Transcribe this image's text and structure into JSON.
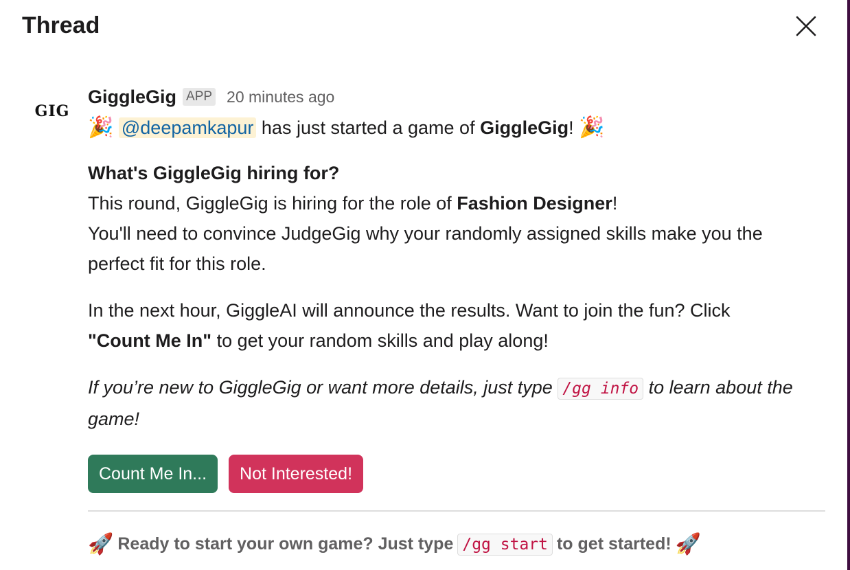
{
  "panel": {
    "title": "Thread"
  },
  "message": {
    "avatar_text": "GIG",
    "sender": "GiggleGig",
    "badge": "APP",
    "timestamp": "20 minutes ago",
    "intro": {
      "emoji": "🎉",
      "mention": "@deepamkapur",
      "text_before_bold": " has just started a game of ",
      "bold": "GiggleGig",
      "text_after_bold": "!"
    },
    "hiring": {
      "heading": "What's GiggleGig hiring for?",
      "line1_prefix": "This round, GiggleGig is hiring for the role of ",
      "role": "Fashion Designer",
      "line1_suffix": "!",
      "line2": "You'll need to convince JudgeGig why your randomly assigned skills make you the",
      "line3": "perfect fit for this role."
    },
    "results": {
      "line1": "In the next hour, GiggleAI will announce the results. Want to join the fun? Click",
      "bold": "\"Count Me In\"",
      "line2_suffix": " to get your random skills and play along!"
    },
    "info": {
      "prefix": "If you’re new to GiggleGig or want more details, just type ",
      "command": "/gg info",
      "suffix": " to learn about the",
      "line2": "game!"
    },
    "buttons": {
      "primary": "Count Me In...",
      "danger": "Not Interested!"
    },
    "footer": {
      "emoji": "🚀",
      "prefix": "Ready to start your own game? Just type",
      "command": "/gg start",
      "suffix": "to get started!"
    }
  },
  "colors": {
    "primary_button": "#2f7a5a",
    "danger_button": "#d1335b",
    "mention_text": "#1264a3",
    "mention_bg": "#fdf2d4",
    "code_text": "#c01343"
  },
  "icons": {
    "close": "close-icon",
    "party": "party-popper-icon",
    "rocket": "rocket-icon"
  }
}
